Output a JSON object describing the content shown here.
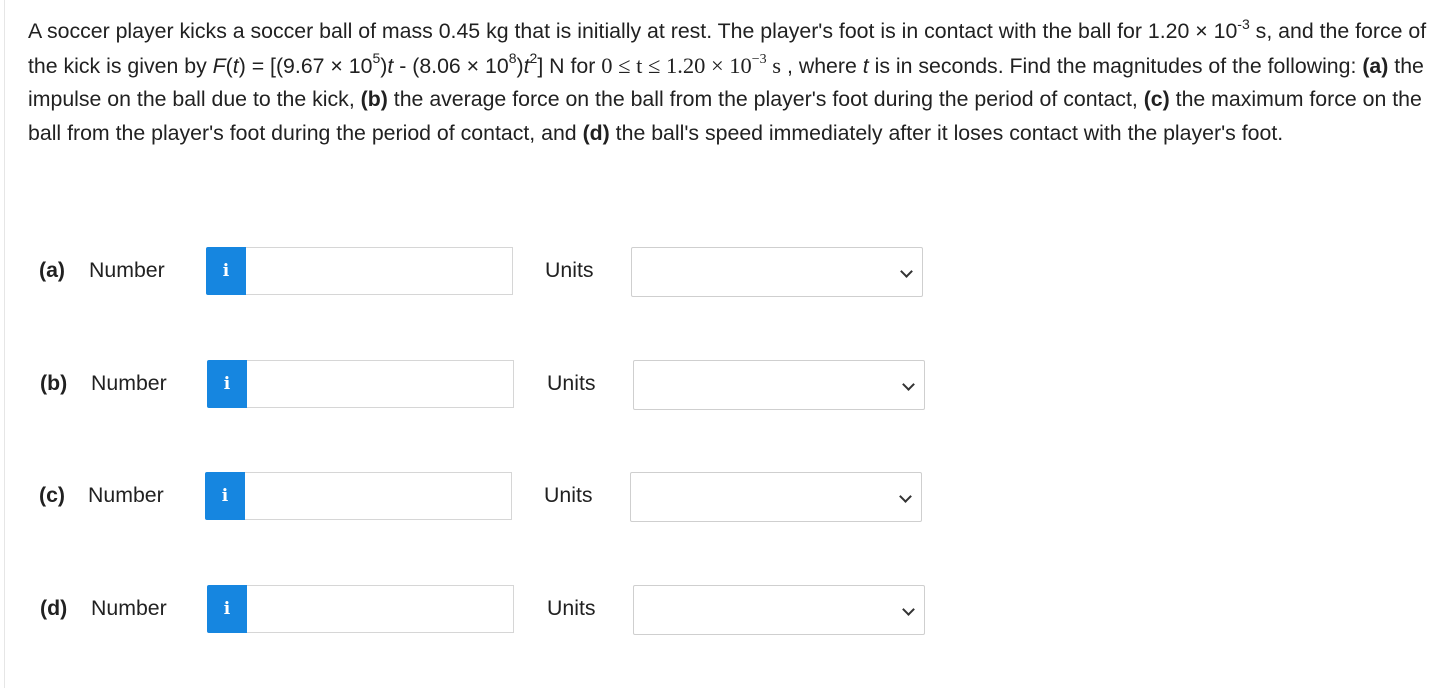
{
  "question": {
    "s1": "A soccer player kicks a soccer ball of mass 0.45 kg that is initially at rest. The player's foot is in contact with the ball for 1.20 × 10",
    "exp_neg3": "-3",
    "s2": " s, and the force of the kick is given by ",
    "f": "F",
    "s3": "(",
    "t1": "t",
    "s4": ") = [(9.67 × 10",
    "exp5": "5",
    "s5": ")",
    "t2": "t",
    "s6": " - (8.06 × 10",
    "exp8": "8",
    "s7": ")",
    "t3": "t",
    "exp2": "2",
    "s8": "] N for ",
    "range_main": "0 ≤ t ≤ 1.20 × 10",
    "range_exp": "−3",
    "range_unit": " s",
    "s9": " , where ",
    "t4": "t",
    "s10": " is in seconds. Find the magnitudes of the following: ",
    "pa": "(a)",
    "sa": " the impulse on the ball due to the kick, ",
    "pb": "(b)",
    "sb": " the average force on the ball from the player's foot during the period of contact, ",
    "pc": "(c)",
    "sc": " the maximum force on the ball from the player's foot during the period of contact, and ",
    "pd": "(d)",
    "sd": " the ball's speed immediately after it loses contact with the player's foot."
  },
  "answers": [
    {
      "part": "(a)",
      "number_label": "Number",
      "info_icon": "i",
      "value": "",
      "units_label": "Units",
      "units_value": ""
    },
    {
      "part": "(b)",
      "number_label": "Number",
      "info_icon": "i",
      "value": "",
      "units_label": "Units",
      "units_value": ""
    },
    {
      "part": "(c)",
      "number_label": "Number",
      "info_icon": "i",
      "value": "",
      "units_label": "Units",
      "units_value": ""
    },
    {
      "part": "(d)",
      "number_label": "Number",
      "info_icon": "i",
      "value": "",
      "units_label": "Units",
      "units_value": ""
    }
  ],
  "colors": {
    "info_button": "#1686e0",
    "text": "#212121"
  }
}
